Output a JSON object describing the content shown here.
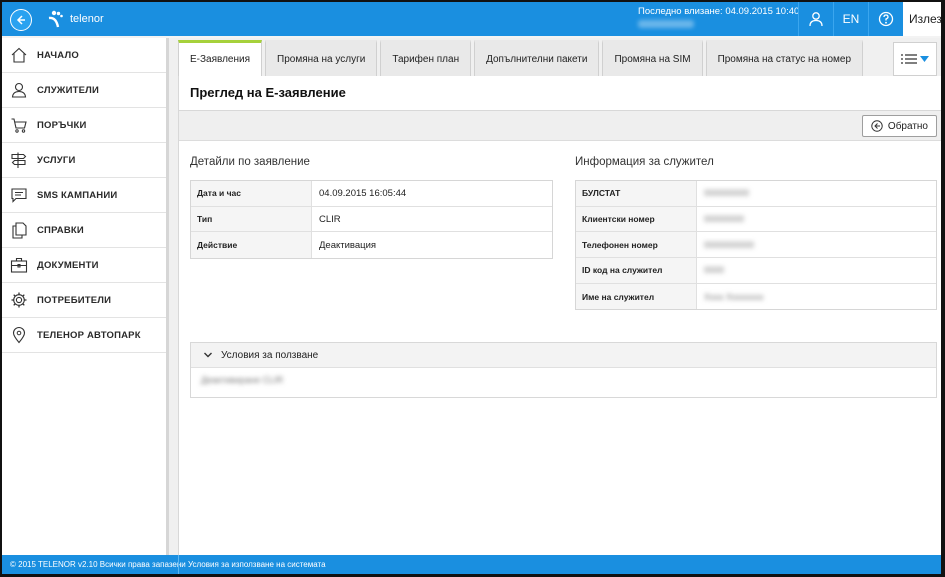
{
  "header": {
    "logo_text": "telenor",
    "last_login_label": "Последно влизане: 04.09.2015 10:40",
    "lang": "EN",
    "logout": "Излез"
  },
  "sidebar": {
    "items": [
      {
        "label": "НАЧАЛО",
        "icon": "home-icon"
      },
      {
        "label": "СЛУЖИТЕЛИ",
        "icon": "user-icon"
      },
      {
        "label": "ПОРЪЧКИ",
        "icon": "cart-icon"
      },
      {
        "label": "УСЛУГИ",
        "icon": "signpost-icon"
      },
      {
        "label": "SMS КАМПАНИИ",
        "icon": "sms-icon"
      },
      {
        "label": "СПРАВКИ",
        "icon": "documents-icon"
      },
      {
        "label": "ДОКУМЕНТИ",
        "icon": "briefcase-icon"
      },
      {
        "label": "ПОТРЕБИТЕЛИ",
        "icon": "gear-icon"
      },
      {
        "label": "ТЕЛЕНОР АВТОПАРК",
        "icon": "location-pin-icon"
      }
    ]
  },
  "tabs": [
    {
      "label": "Е-Заявления",
      "active": true
    },
    {
      "label": "Промяна на услуги",
      "active": false
    },
    {
      "label": "Тарифен план",
      "active": false
    },
    {
      "label": "Допълнителни пакети",
      "active": false
    },
    {
      "label": "Промяна на SIM",
      "active": false
    },
    {
      "label": "Промяна на статус на номер",
      "active": false
    }
  ],
  "page": {
    "title": "Преглед на Е-заявление",
    "back_button": "Обратно"
  },
  "details": {
    "title": "Детайли по заявление",
    "rows": [
      {
        "key": "Дата и час",
        "value": "04.09.2015 16:05:44"
      },
      {
        "key": "Тип",
        "value": "CLIR"
      },
      {
        "key": "Действие",
        "value": "Деактивация"
      }
    ]
  },
  "employee": {
    "title": "Информация за служител",
    "rows": [
      {
        "key": "БУЛСТАТ",
        "value": "000000000"
      },
      {
        "key": "Клиентски номер",
        "value": "00000000"
      },
      {
        "key": "Телефонен номер",
        "value": "0000000000"
      },
      {
        "key": "ID код на служител",
        "value": "0000"
      },
      {
        "key": "Име на служител",
        "value": "Xxxx Xxxxxxxx"
      }
    ]
  },
  "terms": {
    "title": "Условия за ползване",
    "body": "Деактивиране CLIR"
  },
  "footer": {
    "copyright": "© 2015 TELENOR v2.10 Всички права запазени",
    "terms_link": "Условия за използване на системата"
  },
  "colors": {
    "brand_blue": "#1a8fe0",
    "active_tab_accent": "#a6d13b"
  }
}
